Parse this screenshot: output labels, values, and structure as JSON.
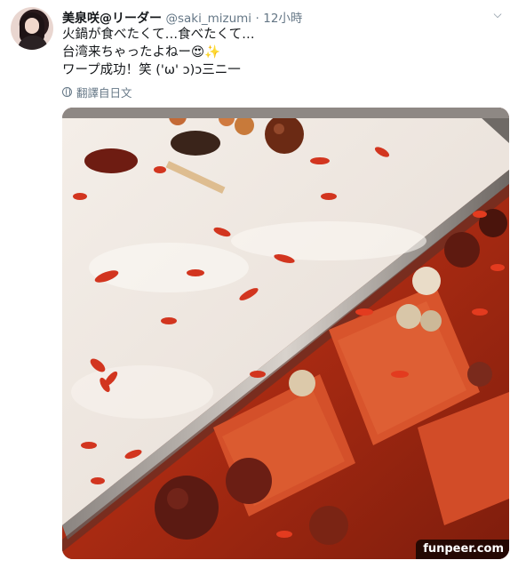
{
  "tweet": {
    "display_name": "美泉咲@リーダー",
    "handle": "@saki_mizumi",
    "separator": "·",
    "time": "12小時",
    "lines": [
      "火鍋が食べたくて…食べたくて…",
      "台湾来ちゃったよねー😍✨",
      "ワープ成功！笑 ('ω' ɔ)ɔ三ニ一"
    ],
    "translate_label": "翻譯自日文",
    "more_icon": "chevron-down-icon"
  },
  "media": {
    "description_icon": "hotpot-photo",
    "watermark": "funpeer.com"
  }
}
